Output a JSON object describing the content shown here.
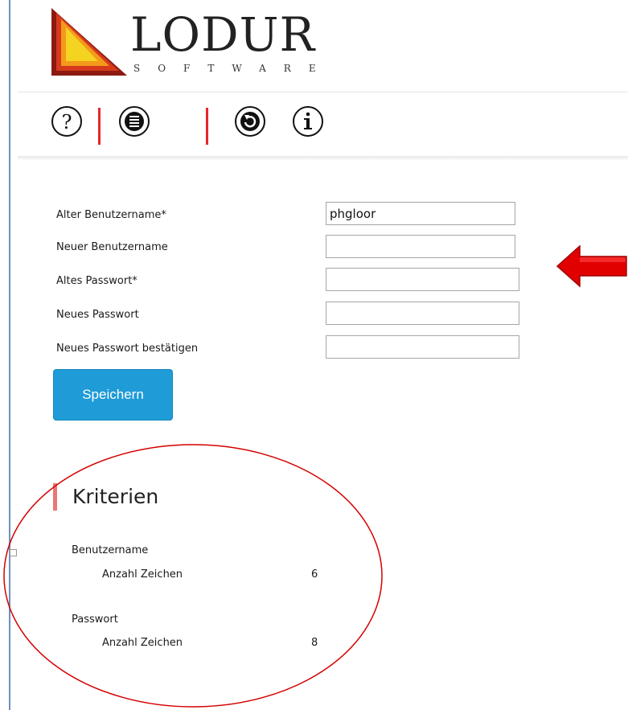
{
  "brand": {
    "name": "LODUR",
    "subtitle": "SOFTWARE"
  },
  "toolbar": {
    "icons": [
      "help-icon",
      "list-icon",
      "refresh-icon",
      "info-icon"
    ]
  },
  "form": {
    "fields": [
      {
        "label": "Alter Benutzername*",
        "value": "phgloor"
      },
      {
        "label": "Neuer Benutzername",
        "value": ""
      },
      {
        "label": "Altes Passwort*",
        "value": ""
      },
      {
        "label": "Neues Passwort",
        "value": ""
      },
      {
        "label": "Neues Passwort bestätigen",
        "value": ""
      }
    ],
    "save_label": "Speichern"
  },
  "criteria": {
    "title": "Kriterien",
    "groups": [
      {
        "name": "Benutzername",
        "item_label": "Anzahl Zeichen",
        "item_value": "6"
      },
      {
        "name": "Passwort",
        "item_label": "Anzahl Zeichen",
        "item_value": "8"
      }
    ]
  },
  "colors": {
    "accent_red": "#e8262b",
    "button_blue": "#1f9bd7",
    "annotation_red": "#d40000"
  }
}
